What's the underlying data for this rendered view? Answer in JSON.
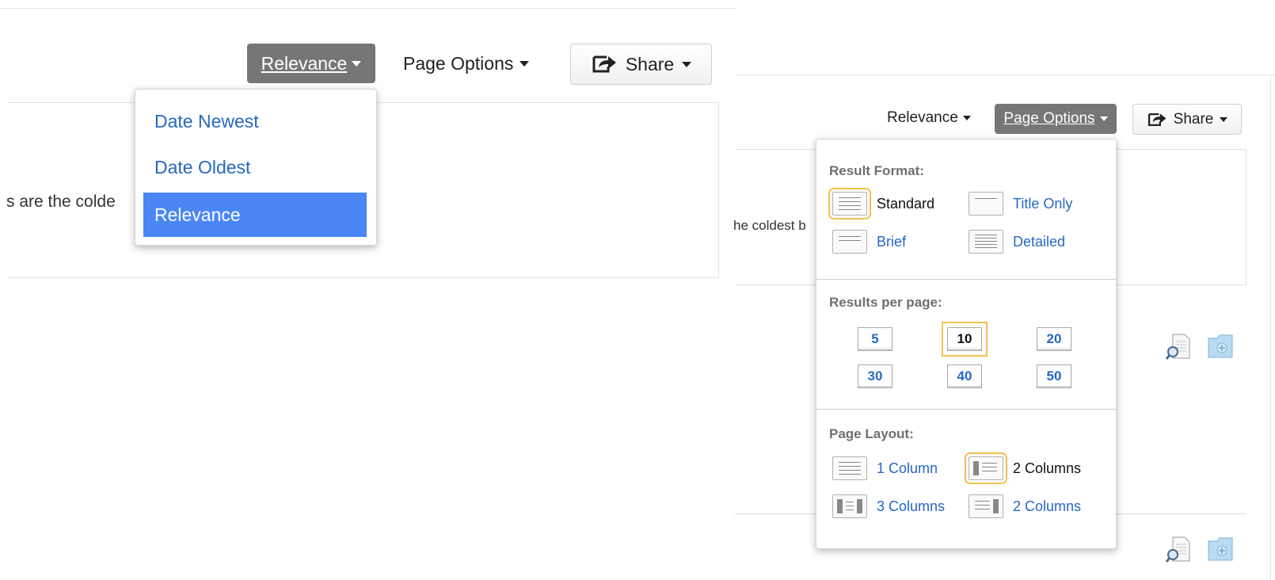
{
  "left_panel": {
    "snippet": "s are the colde",
    "sort_button": "Relevance",
    "page_options_button": "Page Options",
    "share_button": "Share",
    "sort_menu": [
      "Date Newest",
      "Date Oldest",
      "Relevance"
    ]
  },
  "right_panel": {
    "snippet": "he coldest b",
    "sort_button": "Relevance",
    "page_options_button": "Page Options",
    "share_button": "Share",
    "page_options": {
      "result_format_title": "Result Format:",
      "formats": [
        "Standard",
        "Title Only",
        "Brief",
        "Detailed"
      ],
      "results_per_page_title": "Results per page:",
      "per_page": [
        "5",
        "10",
        "20",
        "30",
        "40",
        "50"
      ],
      "page_layout_title": "Page Layout:",
      "layouts": [
        "1 Column",
        "2 Columns",
        "3 Columns",
        "2 Columns"
      ]
    }
  },
  "colors": {
    "link": "#2767c4",
    "selected_bg": "#4a86f5",
    "dark_button": "#767676",
    "current_outline": "#f2c14e"
  }
}
